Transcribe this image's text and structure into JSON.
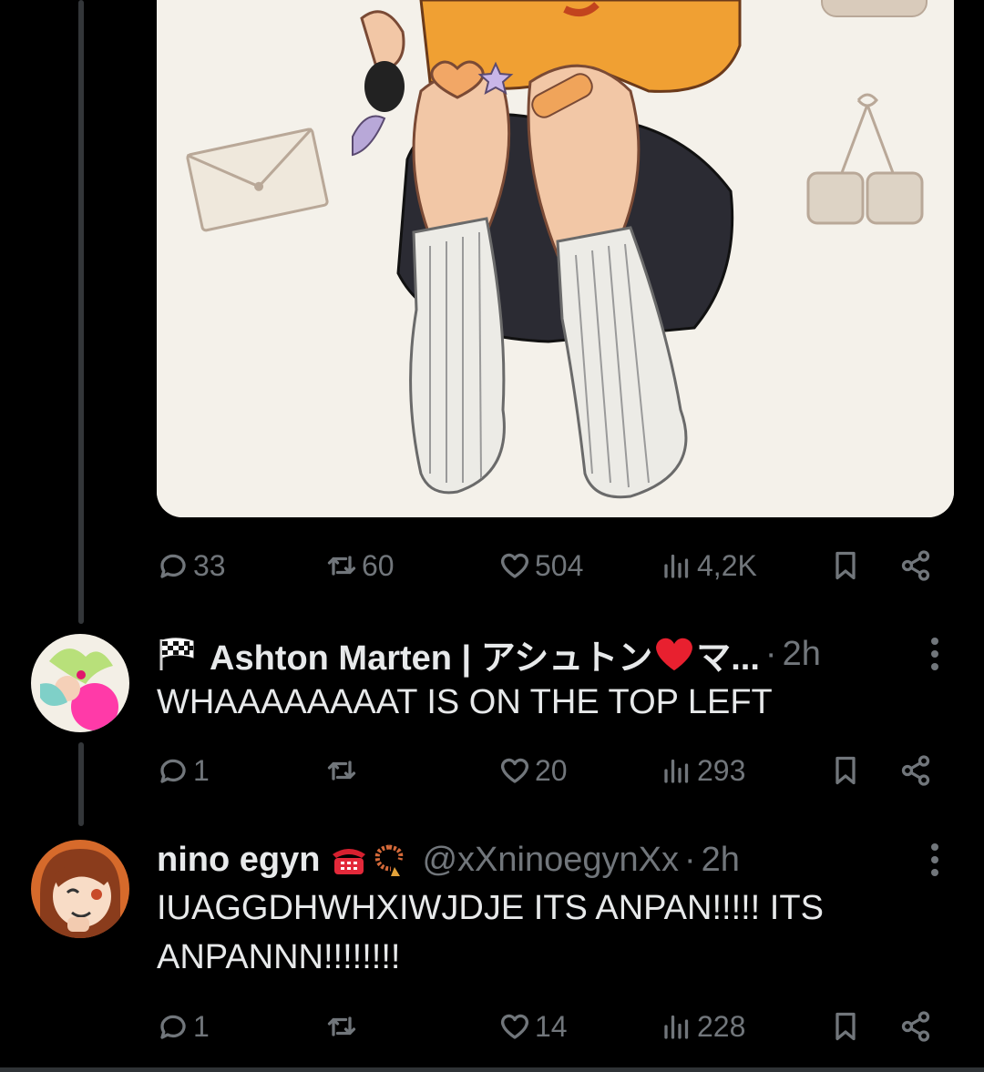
{
  "post": {
    "actions": {
      "replies": "33",
      "reposts": "60",
      "likes": "504",
      "views": "4,2K"
    }
  },
  "replies": [
    {
      "display_name": "Ashton Marten | アシュトン",
      "display_name_suffix": "マ...",
      "flag_emoji": "checkered-flag",
      "heart_emoji": "red-heart",
      "handle": "",
      "separator": "·",
      "time": "2h",
      "text": "WHAAAAAAAAT IS ON THE TOP LEFT",
      "actions": {
        "replies": "1",
        "reposts": "",
        "likes": "20",
        "views": "293"
      }
    },
    {
      "display_name": "nino egyn",
      "emojis": [
        "telephone",
        "prayer-beads"
      ],
      "handle": "@xXninoegynXx",
      "separator": "·",
      "time": "2h",
      "text": "IUAGGDHWHXIWJDJE ITS ANPAN!!!!! ITS ANPANNN!!!!!!!!",
      "actions": {
        "replies": "1",
        "reposts": "",
        "likes": "14",
        "views": "228"
      }
    }
  ],
  "colors": {
    "background": "#000000",
    "text_primary": "#e7e9ea",
    "text_secondary": "#71767b",
    "thread_line": "#333639",
    "media_background": "#f4f1ea"
  }
}
